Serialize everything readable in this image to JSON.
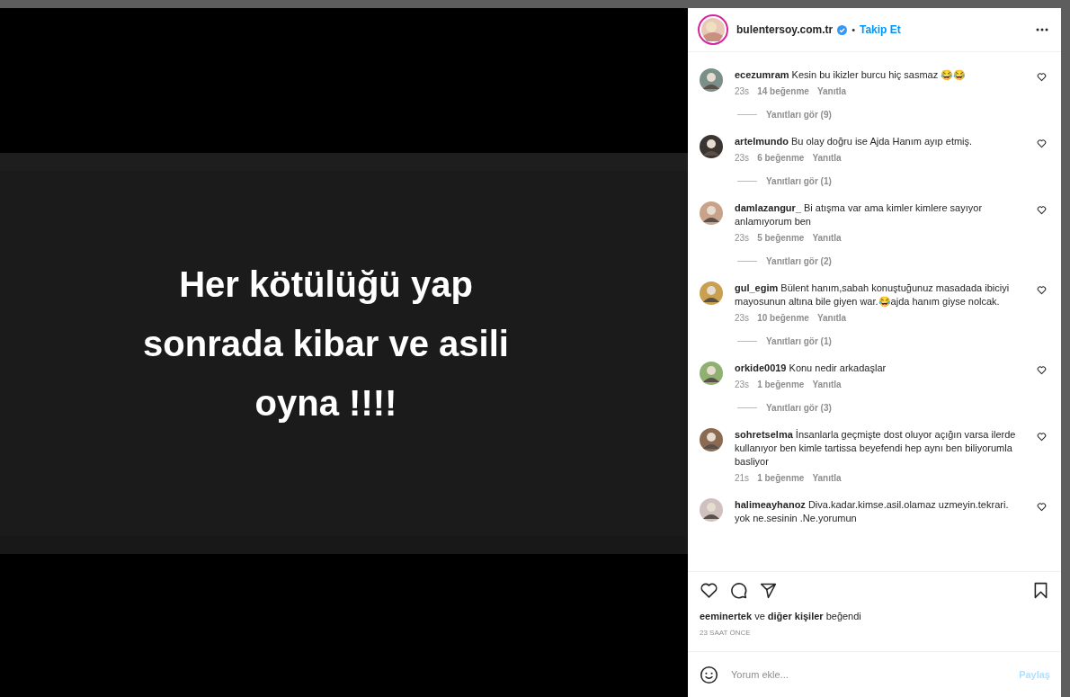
{
  "post_image": {
    "kind": "picture",
    "caption": "Her kötülüğü yap\nsonrada kibar ve asili\noyna !!!!"
  },
  "header": {
    "username": "bulentersoy.com.tr",
    "verified": true,
    "separator": "•",
    "follow": "Takip Et"
  },
  "comments": [
    {
      "user": "ecezumram",
      "text": "Kesin bu ikizler burcu hiç sasmaz 😂😂",
      "time": "23s",
      "likes": "14 beğenme",
      "reply": "Yanıtla",
      "view_replies": "Yanıtları gör (9)"
    },
    {
      "user": "artelmundo",
      "text": "Bu olay doğru ise Ajda Hanım ayıp etmiş.",
      "time": "23s",
      "likes": "6 beğenme",
      "reply": "Yanıtla",
      "view_replies": "Yanıtları gör (1)"
    },
    {
      "user": "damlazangur_",
      "text": "Bi atışma var ama kimler kimlere sayıyor anlamıyorum ben",
      "time": "23s",
      "likes": "5 beğenme",
      "reply": "Yanıtla",
      "view_replies": "Yanıtları gör (2)"
    },
    {
      "user": "gul_egim",
      "text": "Bülent hanım,sabah konuştuğunuz masadada ibiciyi mayosunun altına bile giyen war.😂ajda hanım giyse nolcak.",
      "time": "23s",
      "likes": "10 beğenme",
      "reply": "Yanıtla",
      "view_replies": "Yanıtları gör (1)"
    },
    {
      "user": "orkide0019",
      "text": "Konu nedir arkadaşlar",
      "time": "23s",
      "likes": "1 beğenme",
      "reply": "Yanıtla",
      "view_replies": "Yanıtları gör (3)"
    },
    {
      "user": "sohretselma",
      "text": "İnsanlarla geçmişte dost oluyor açığın varsa ilerde kullanıyor ben kimle tartissa beyefendi hep aynı ben biliyorumla basliyor",
      "time": "21s",
      "likes": "1 beğenme",
      "reply": "Yanıtla"
    },
    {
      "user": "halimeayhanoz",
      "text": "Diva.kadar.kimse.asil.olamaz uzmeyin.tekrari. yok ne.sesinin .Ne.yorumun"
    }
  ],
  "likes_line": {
    "user": "eeminertek",
    "middle": "ve",
    "others": "diğer kişiler",
    "end": "beğendi"
  },
  "timestamp": "23 SAAT ÖNCE",
  "comment_box": {
    "placeholder": "Yorum ekle...",
    "button": "Paylaş"
  }
}
